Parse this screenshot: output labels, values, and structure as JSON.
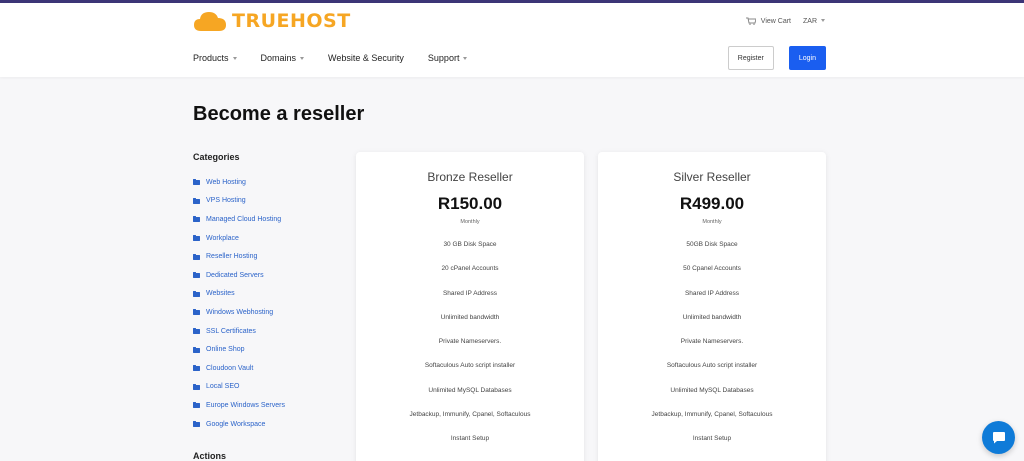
{
  "brand": {
    "name": "TRUEHOST",
    "color": "#f6a623",
    "icon": "cloud-icon"
  },
  "header": {
    "view_cart": "View Cart",
    "currency": "ZAR",
    "register": "Register",
    "login": "Login",
    "nav": [
      {
        "label": "Products",
        "dropdown": true
      },
      {
        "label": "Domains",
        "dropdown": true
      },
      {
        "label": "Website & Security",
        "dropdown": false
      },
      {
        "label": "Support",
        "dropdown": true
      }
    ]
  },
  "page_title": "Become a reseller",
  "sidebar": {
    "title": "Categories",
    "items": [
      "Web Hosting",
      "VPS Hosting",
      "Managed Cloud Hosting",
      "Workplace",
      "Reseller Hosting",
      "Dedicated Servers",
      "Websites",
      "Windows Webhosting",
      "SSL Certificates",
      "Online Shop",
      "Cloudoon Vault",
      "Local SEO",
      "Europe Windows Servers",
      "Google Workspace"
    ],
    "actions_title": "Actions"
  },
  "plans": [
    {
      "name": "Bronze Reseller",
      "price": "R150.00",
      "period": "Monthly",
      "features": [
        "30 GB Disk Space",
        "20 cPanel Accounts",
        "Shared IP Address",
        "Unlimited bandwidth",
        "Private Nameservers.",
        "Softaculous Auto script installer",
        "Unlimited MySQL Databases",
        "Jetbackup, Immunify, Cpanel, Softaculous",
        "Instant Setup"
      ]
    },
    {
      "name": "Silver Reseller",
      "price": "R499.00",
      "period": "Monthly",
      "features": [
        "50GB Disk Space",
        "50 Cpanel Accounts",
        "Shared IP Address",
        "Unlimited bandwidth",
        "Private Nameservers.",
        "Softaculous Auto script installer",
        "Unlimited MySQL Databases",
        "Jetbackup, Immunify, Cpanel, Softaculous",
        "Instant Setup"
      ]
    }
  ],
  "colors": {
    "accent": "#1a5ef0",
    "link": "#2b63c9",
    "chat": "#0f7bd8"
  }
}
